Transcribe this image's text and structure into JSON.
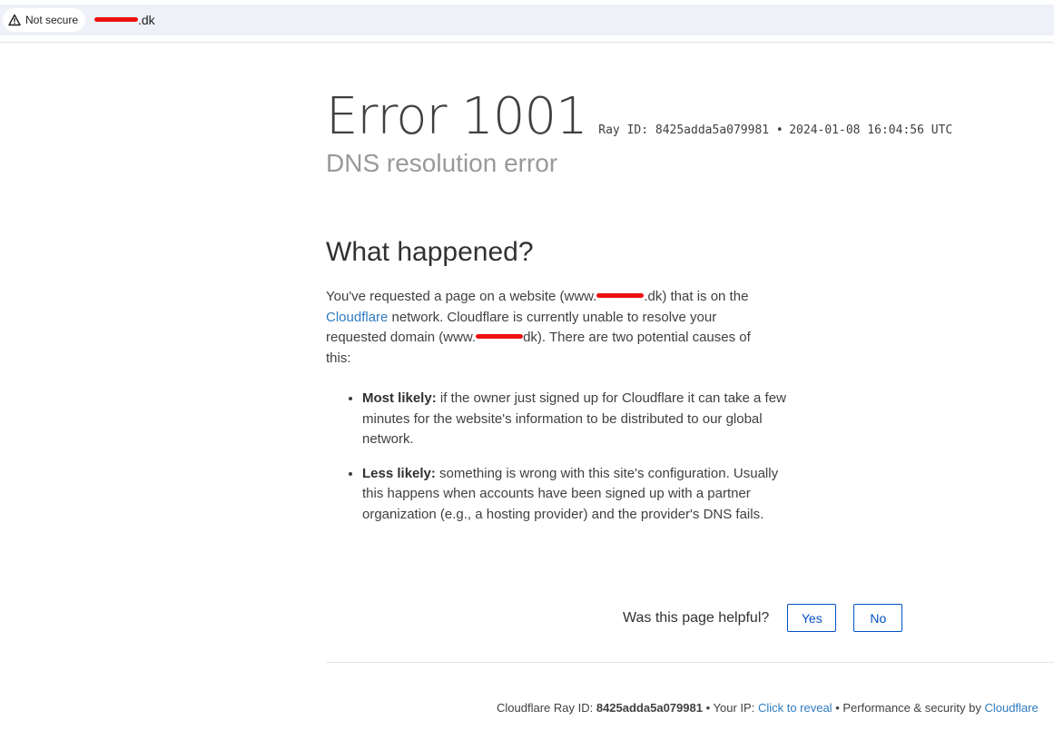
{
  "browser": {
    "security_label": "Not secure",
    "url_suffix": ".dk"
  },
  "error": {
    "title": "Error 1001",
    "ray_text": "Ray ID: 8425adda5a079981 •",
    "timestamp": "2024-01-08 16:04:56 UTC",
    "subtitle": "DNS resolution error"
  },
  "what_happened": {
    "heading": "What happened?",
    "p1_a": "You've requested a page on a website (www.",
    "p1_b": ".dk) that is on the",
    "p1_link": "Cloudflare",
    "p1_c": " network. Cloudflare is currently unable to resolve your requested domain (www.",
    "p1_d": "dk). There are two potential causes of this:",
    "causes": [
      {
        "label": "Most likely:",
        "text": " if the owner just signed up for Cloudflare it can take a few minutes for the website's information to be distributed to our global network."
      },
      {
        "label": "Less likely:",
        "text": " something is wrong with this site's configuration. Usually this happens when accounts have been signed up with a partner organization (e.g., a hosting provider) and the provider's DNS fails."
      }
    ]
  },
  "feedback": {
    "question": "Was this page helpful?",
    "yes": "Yes",
    "no": "No"
  },
  "footer": {
    "ray_label": "Cloudflare Ray ID:",
    "ray_id": "8425adda5a079981",
    "sep1": "•",
    "ip_label": "Your IP:",
    "ip_link": "Click to reveal",
    "sep2": "•",
    "perf_text": "Performance & security by",
    "perf_link": "Cloudflare"
  },
  "colors": {
    "link": "#2f7bbf",
    "button": "#0051c3",
    "redaction": "#ee1111"
  }
}
